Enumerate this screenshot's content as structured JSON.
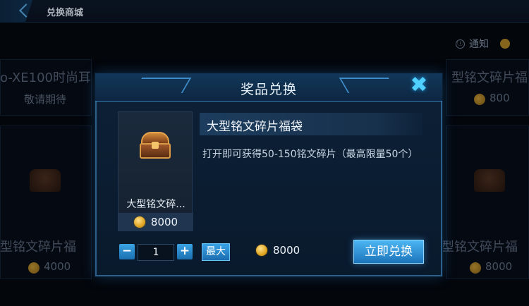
{
  "top_bar": {
    "title": "兑换商城"
  },
  "notice": {
    "info_icon": "ⓘ",
    "label": "通知"
  },
  "background": {
    "left_top_name": "o-XE100时尚耳",
    "left_top_sub": "敬请期待",
    "right_top_name": "型铭文碎片福",
    "right_top_price": "800",
    "left_bottom_name": "型铭文碎片福",
    "left_bottom_price": "4000",
    "right_bottom_name": "型铭文碎片福",
    "right_bottom_price": "8000"
  },
  "modal": {
    "title": "奖品兑换",
    "close_icon": "✖",
    "item": {
      "card_name": "大型铭文碎...",
      "card_price": "8000",
      "name": "大型铭文碎片福袋",
      "description": "打开即可获得50-150铭文碎片（最高限量50个）"
    },
    "quantity": {
      "minus": "−",
      "value": "1",
      "plus": "+"
    },
    "max_label": "最大",
    "total_price": "8000",
    "exchange_label": "立即兑换"
  },
  "colors": {
    "accent": "#2f8fd6",
    "coin": "#e0a520",
    "button": "#1c74bb"
  }
}
